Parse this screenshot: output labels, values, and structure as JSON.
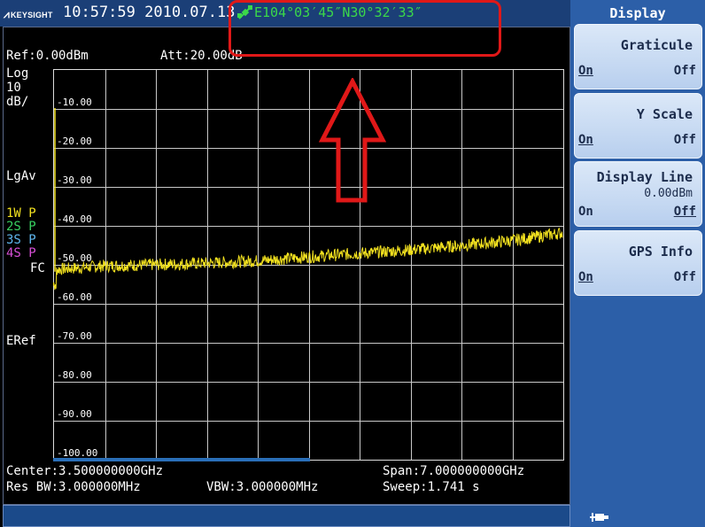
{
  "header": {
    "brand": "KEYSIGHT",
    "datetime": "10:57:59 2010.07.13",
    "gps_coords": "E104°03′45″N30°32′33″"
  },
  "screen": {
    "ref": "Ref:0.00dBm",
    "att": "Att:20.00dB",
    "scale_type": "Log",
    "scale_value": "10",
    "scale_unit": "dB/",
    "avg_mode": "LgAv",
    "traces": [
      {
        "label": "1W",
        "flag": "P",
        "color": "#f2e11f"
      },
      {
        "label": "2S",
        "flag": "P",
        "color": "#38d060"
      },
      {
        "label": "3S",
        "flag": "P",
        "color": "#5fb7ee"
      },
      {
        "label": "4S",
        "flag": "P",
        "color": "#d64fd6"
      }
    ],
    "coupling": "FC",
    "ext_ref": "ERef",
    "y_ticks": [
      "-10.00",
      "-20.00",
      "-30.00",
      "-40.00",
      "-50.00",
      "-60.00",
      "-70.00",
      "-80.00",
      "-90.00",
      "-100.00"
    ],
    "center": "Center:3.500000000GHz",
    "span": "Span:7.000000000GHz",
    "res_bw": "Res BW:3.000000MHz",
    "vbw": "VBW:3.000000MHz",
    "sweep": "Sweep:1.741 s"
  },
  "panel": {
    "title": "Display",
    "softkeys": [
      {
        "label": "Graticule",
        "on": "On",
        "off": "Off",
        "selected": "On",
        "value": ""
      },
      {
        "label": "Y Scale",
        "on": "On",
        "off": "Off",
        "selected": "On",
        "value": ""
      },
      {
        "label": "Display Line",
        "on": "On",
        "off": "Off",
        "selected": "Off",
        "value": "0.00dBm"
      },
      {
        "label": "GPS Info",
        "on": "On",
        "off": "Off",
        "selected": "On",
        "value": ""
      }
    ]
  },
  "chart_data": {
    "type": "line",
    "title": "",
    "xlabel": "",
    "ylabel": "",
    "x_range": [
      0,
      7
    ],
    "ylim": [
      -100,
      0
    ],
    "series": [
      {
        "color": "#f2e11f",
        "x": [
          0,
          0.7,
          1.4,
          2.1,
          2.8,
          3.5,
          4.2,
          4.9,
          5.6,
          6.3,
          7.0
        ],
        "y": [
          -51.5,
          -50.5,
          -50.2,
          -49.8,
          -49.2,
          -48.2,
          -47.3,
          -46.4,
          -45.3,
          -44.0,
          -42.0
        ]
      }
    ],
    "colors": {
      "trace": "#f2e11f",
      "grid": "#c8c8c8",
      "annotation": "#e01818"
    }
  }
}
